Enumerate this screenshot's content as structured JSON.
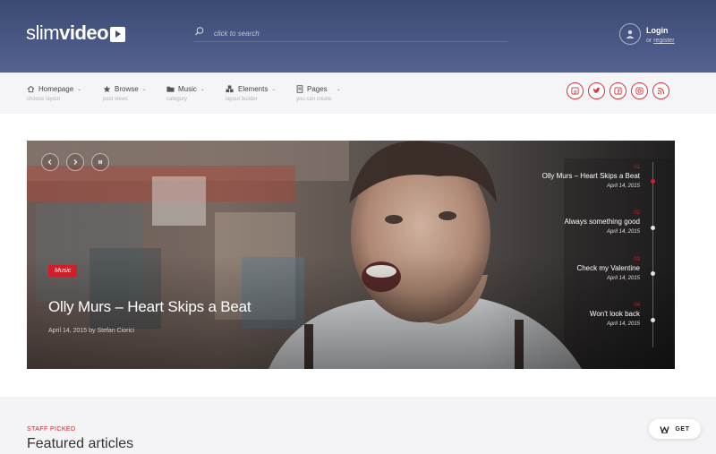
{
  "brand": {
    "light": "slim",
    "bold": "video"
  },
  "search": {
    "placeholder": "click to search"
  },
  "account": {
    "login": "Login",
    "or": "or",
    "register": "register"
  },
  "nav": [
    {
      "label": "Homepage",
      "sub": "choose layout",
      "icon": "home-icon"
    },
    {
      "label": "Browse",
      "sub": "post views",
      "icon": "star-icon"
    },
    {
      "label": "Music",
      "sub": "category",
      "icon": "folder-icon"
    },
    {
      "label": "Elements",
      "sub": "layout builder",
      "icon": "cubes-icon"
    },
    {
      "label": "Pages",
      "sub": "you can create",
      "icon": "page-icon"
    }
  ],
  "social": [
    "google-plus-icon",
    "twitter-icon",
    "facebook-icon",
    "instagram-icon",
    "rss-icon"
  ],
  "hero": {
    "category": "Music",
    "title": "Olly Murs – Heart Skips a Beat",
    "meta": "April 14, 2015 by Stefan Ciorici",
    "timeline": [
      {
        "num": "01",
        "title": "Olly Murs – Heart Skips a Beat",
        "date": "April 14, 2015",
        "active": true
      },
      {
        "num": "02",
        "title": "Always something good",
        "date": "April 14, 2015",
        "active": false
      },
      {
        "num": "03",
        "title": "Check my Valentine",
        "date": "April 14, 2015",
        "active": false
      },
      {
        "num": "04",
        "title": "Won't look back",
        "date": "April 14, 2015",
        "active": false
      }
    ]
  },
  "featured": {
    "kicker": "STAFF PICKED",
    "title": "Featured articles"
  },
  "get_button": {
    "label": "GET"
  },
  "colors": {
    "header": "#44527e",
    "accent": "#d01f2a",
    "nav_bg": "#f5f5f7"
  }
}
